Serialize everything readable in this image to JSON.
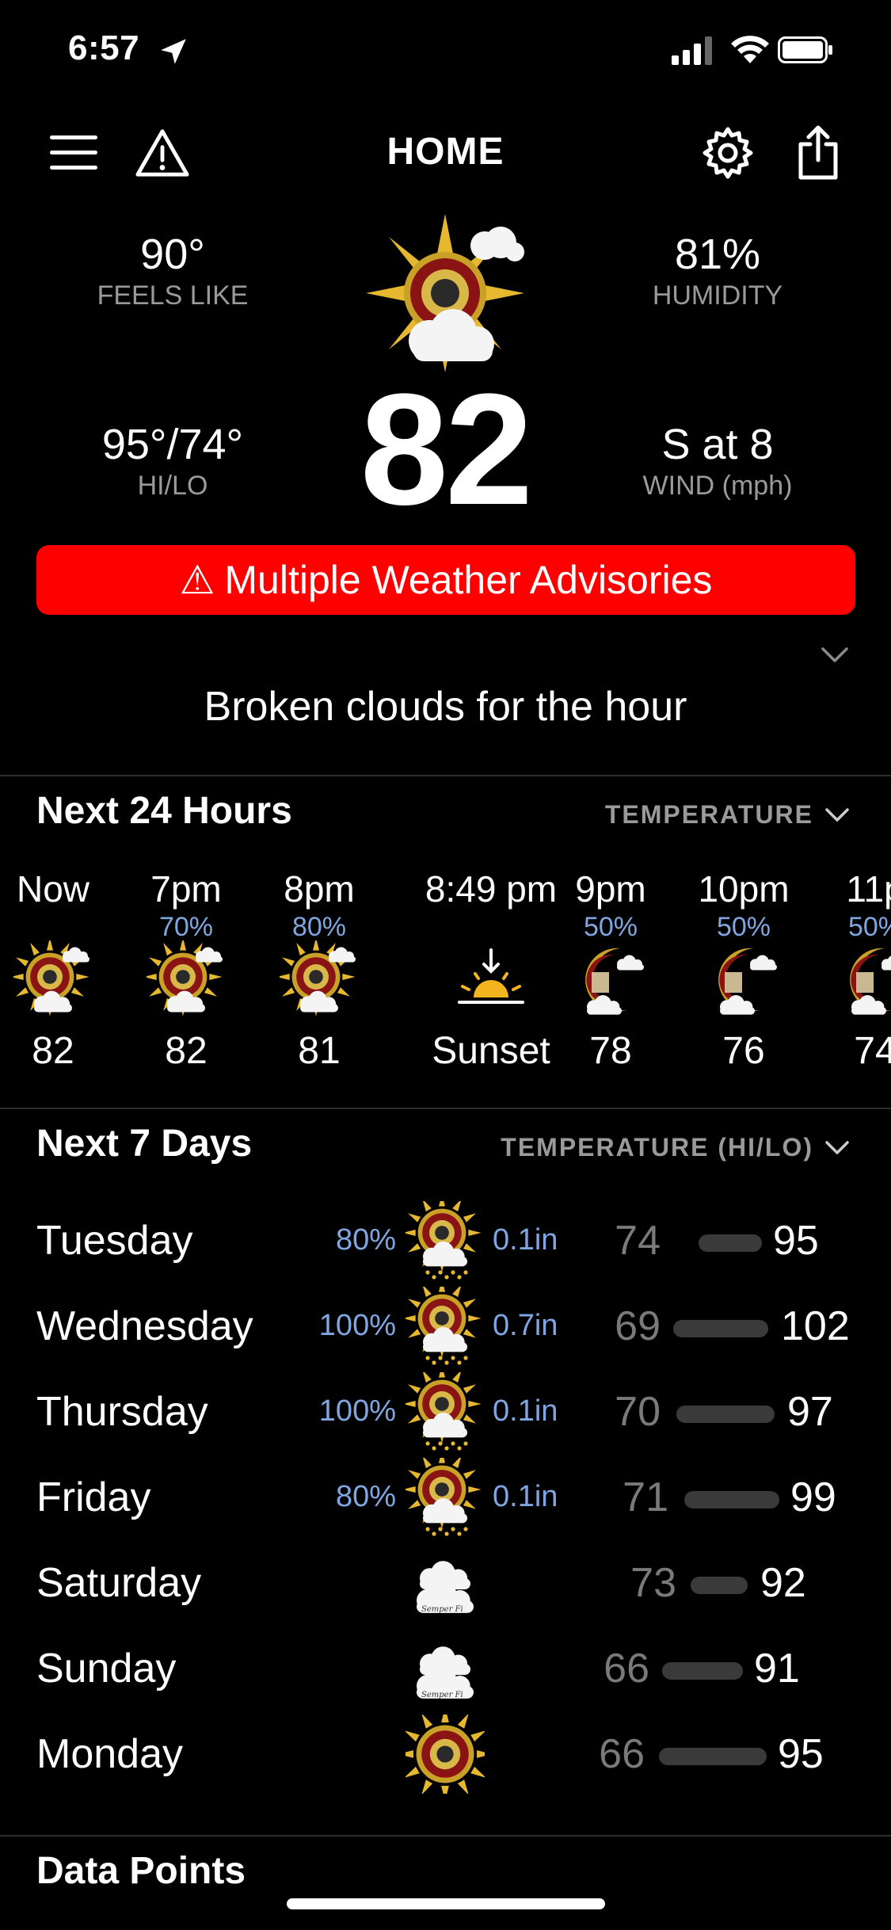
{
  "status_bar": {
    "time": "6:57"
  },
  "header": {
    "title": "HOME"
  },
  "current": {
    "feels_like": "90°",
    "feels_like_label": "FEELS LIKE",
    "humidity": "81%",
    "humidity_label": "HUMIDITY",
    "hilo": "95°/74°",
    "hilo_label": "HI/LO",
    "temp": "82",
    "wind": "S at 8",
    "wind_label": "WIND (mph)",
    "advisory": "Multiple Weather Advisories",
    "advisory_icon": "⚠",
    "summary": "Broken clouds for the hour"
  },
  "hourly": {
    "title": "Next 24 Hours",
    "selector": "TEMPERATURE",
    "items": [
      {
        "time": "Now",
        "precip": "",
        "icon": "partly-sunny-icon",
        "value": "82"
      },
      {
        "time": "7pm",
        "precip": "70%",
        "icon": "partly-sunny-icon",
        "value": "82"
      },
      {
        "time": "8pm",
        "precip": "80%",
        "icon": "partly-sunny-icon",
        "value": "81"
      },
      {
        "time": "8:49 pm",
        "precip": "",
        "icon": "sunset-icon",
        "value": "Sunset"
      },
      {
        "time": "9pm",
        "precip": "50%",
        "icon": "partly-cloudy-night-icon",
        "value": "78"
      },
      {
        "time": "10pm",
        "precip": "50%",
        "icon": "partly-cloudy-night-icon",
        "value": "76"
      },
      {
        "time": "11p",
        "precip": "50%",
        "icon": "partly-cloudy-night-icon",
        "value": "74"
      }
    ]
  },
  "daily": {
    "title": "Next 7 Days",
    "selector": "TEMPERATURE (HI/LO)",
    "items": [
      {
        "day": "Tuesday",
        "precip": "80%",
        "icon": "rain-sun-icon",
        "amount": "0.1in",
        "lo": "74",
        "hi": "95"
      },
      {
        "day": "Wednesday",
        "precip": "100%",
        "icon": "rain-sun-icon",
        "amount": "0.7in",
        "lo": "69",
        "hi": "102"
      },
      {
        "day": "Thursday",
        "precip": "100%",
        "icon": "rain-sun-icon",
        "amount": "0.1in",
        "lo": "70",
        "hi": "97"
      },
      {
        "day": "Friday",
        "precip": "80%",
        "icon": "rain-sun-icon",
        "amount": "0.1in",
        "lo": "71",
        "hi": "99"
      },
      {
        "day": "Saturday",
        "precip": "",
        "icon": "cloudy-icon",
        "amount": "",
        "lo": "73",
        "hi": "92"
      },
      {
        "day": "Sunday",
        "precip": "",
        "icon": "cloudy-icon",
        "amount": "",
        "lo": "66",
        "hi": "91"
      },
      {
        "day": "Monday",
        "precip": "",
        "icon": "sunny-icon",
        "amount": "",
        "lo": "66",
        "hi": "95"
      }
    ]
  },
  "data_points": {
    "title": "Data Points"
  },
  "colors": {
    "advisory_bg": "#ff0000",
    "precip_text": "#7fa6e0",
    "muted_text": "#9a9a9a"
  }
}
